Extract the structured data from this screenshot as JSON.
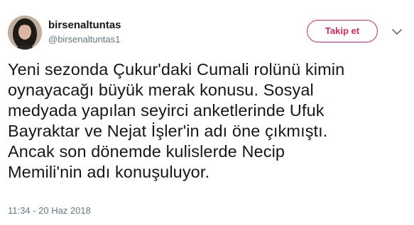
{
  "user": {
    "display_name": "birsenaltuntas",
    "handle": "@birsenaltuntas1",
    "avatar_icon": "profile-photo"
  },
  "actions": {
    "follow_label": "Takip et",
    "more_icon": "chevron-down-icon"
  },
  "tweet": {
    "text": "Yeni sezonda Çukur'daki Cumali rolünü kimin\noynayacağı büyük merak konusu. Sosyal\nmedyada yapılan seyirci anketlerinde Ufuk\nBayraktar ve Nejat İşler'in adı öne çıkmıştı.\nAncak son dönemde kulislerde Necip\nMemili'nin adı konuşuluyor.",
    "timestamp": "11:34 - 20 Haz 2018"
  },
  "colors": {
    "accent": "#e0245e",
    "text": "#14171a",
    "secondary": "#657786"
  }
}
